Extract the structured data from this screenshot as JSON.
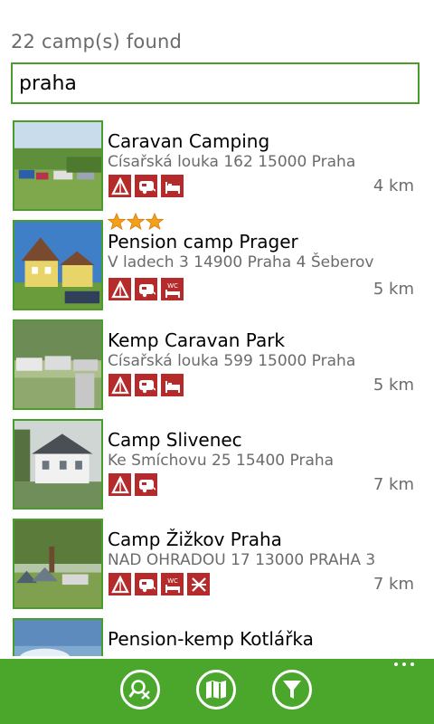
{
  "header": {
    "result_count": "22 camp(s) found"
  },
  "search": {
    "value": "praha"
  },
  "camps": [
    {
      "name": "Caravan Camping",
      "address": "Císařská louka 162 15000 Praha",
      "distance": "4 km",
      "stars": 0,
      "amenities": [
        "tent-icon",
        "caravan-icon",
        "bed-icon"
      ]
    },
    {
      "name": "Pension camp Prager",
      "address": "V ladech 3 14900 Praha 4 Šeberov",
      "distance": "5 km",
      "stars": 3,
      "amenities": [
        "tent-icon",
        "caravan-icon",
        "wc-bed-icon"
      ]
    },
    {
      "name": "Kemp Caravan Park",
      "address": "Císařská louka 599 15000 Praha",
      "distance": "5 km",
      "stars": 0,
      "amenities": [
        "tent-icon",
        "caravan-icon",
        "bed-icon"
      ]
    },
    {
      "name": "Camp Slivenec",
      "address": "Ke Smíchovu 25 15400 Praha",
      "distance": "7 km",
      "stars": 0,
      "amenities": [
        "tent-icon",
        "caravan-icon"
      ]
    },
    {
      "name": "Camp Žižkov Praha",
      "address": "NAD OHRADOU 17 13000 PRAHA 3",
      "distance": "7 km",
      "stars": 0,
      "amenities": [
        "tent-icon",
        "caravan-icon",
        "wc-bed-icon",
        "tables-icon"
      ]
    },
    {
      "name": "Pension-kemp Kotlářka",
      "address": "",
      "distance": "",
      "stars": 0,
      "amenities": []
    }
  ],
  "appbar": {
    "buttons": [
      "clear-search-icon",
      "map-icon",
      "filter-icon"
    ],
    "more": "more-icon"
  },
  "colors": {
    "accent": "#4aa72c",
    "amenity": "#b52a2a",
    "star": "#f2a01c"
  }
}
